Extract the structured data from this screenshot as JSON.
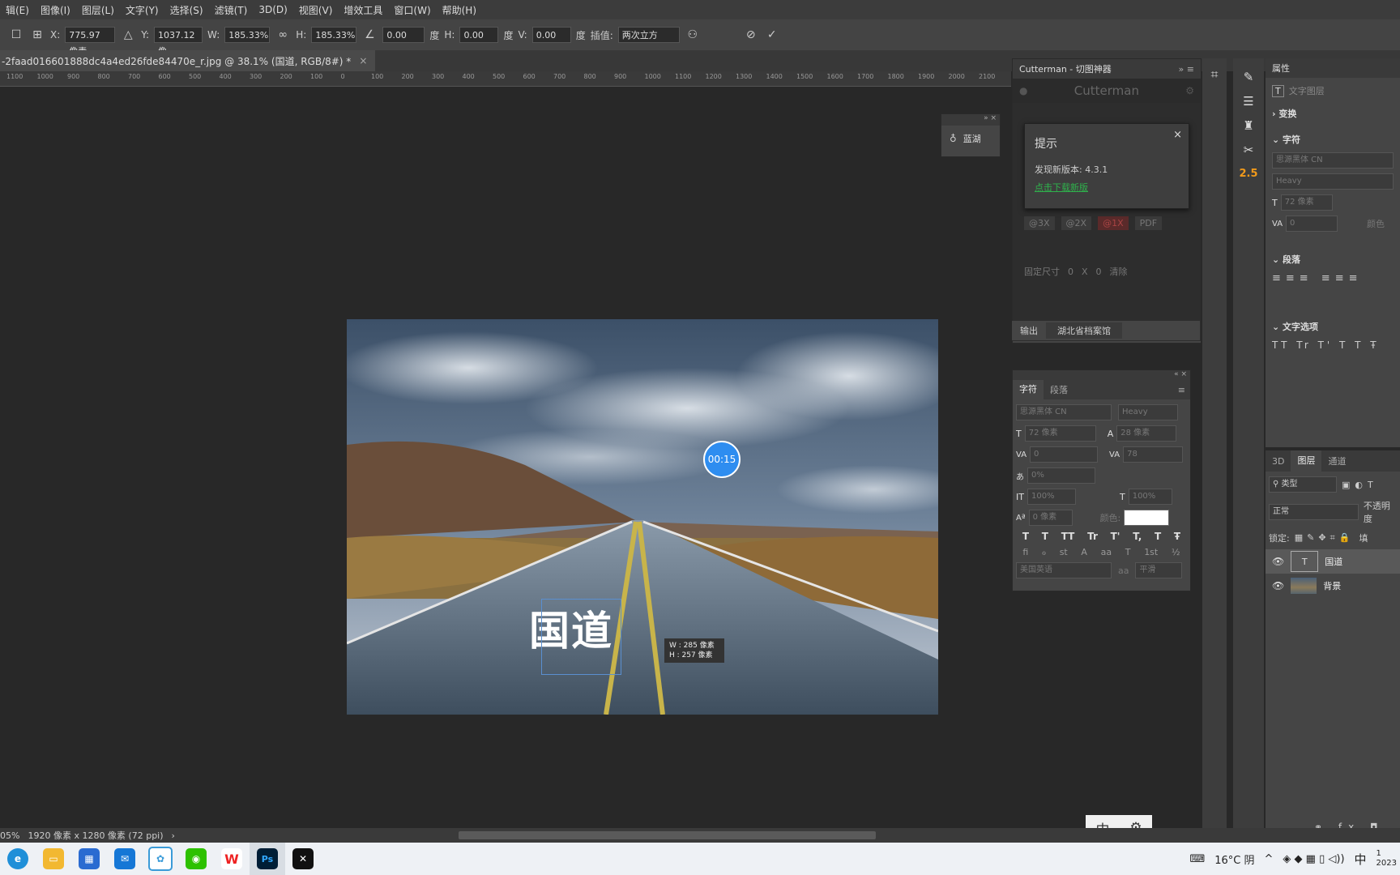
{
  "menu": [
    "辑(E)",
    "图像(I)",
    "图层(L)",
    "文字(Y)",
    "选择(S)",
    "滤镜(T)",
    "3D(D)",
    "视图(V)",
    "增效工具",
    "窗口(W)",
    "帮助(H)"
  ],
  "options": {
    "x_label": "X:",
    "x_value": "775.97 像素",
    "y_label": "Y:",
    "y_value": "1037.12 像",
    "w_label": "W:",
    "w_value": "185.33%",
    "h_label": "H:",
    "h_value": "185.33%",
    "angle_value": "0.00",
    "deg": "度",
    "hskew_label": "H:",
    "hskew_value": "0.00",
    "vskew_label": "V:",
    "vskew_value": "0.00",
    "interp_label": "插值:",
    "interp_value": "两次立方"
  },
  "doc_tab": {
    "title": "-2faad016601888dc4a4ed26fde84470e_r.jpg @ 38.1% (国道, RGB/8#) *",
    "close": "×"
  },
  "ruler_ticks": [
    "1100",
    "1000",
    "900",
    "800",
    "700",
    "600",
    "500",
    "400",
    "300",
    "200",
    "100",
    "0",
    "100",
    "200",
    "300",
    "400",
    "500",
    "600",
    "700",
    "800",
    "900",
    "1000",
    "1100",
    "1200",
    "1300",
    "1400",
    "1500",
    "1600",
    "1700",
    "1800",
    "1900",
    "2000",
    "2100"
  ],
  "canvas": {
    "text": "国道",
    "timer": "00:15",
    "tooltip_w": "W :  285 像素",
    "tooltip_h": "H :  257 像素"
  },
  "float_panel": {
    "label": "蓝湖"
  },
  "cutterman": {
    "tab": "Cutterman - 切图神器",
    "brand": "Cutterman",
    "dialog_title": "提示",
    "dialog_msg": "发现新版本: 4.3.1",
    "dialog_link": "点击下载新版",
    "scales": [
      "@3X",
      "@2X",
      "@1X",
      "PDF"
    ],
    "fixed_label": "固定尺寸",
    "fixed_w": "0",
    "fixed_x": "X",
    "fixed_h": "0",
    "clear": "清除",
    "output_label": "输出",
    "output_path": "湖北省档案馆"
  },
  "char_panel": {
    "tabs": [
      "字符",
      "段落"
    ],
    "font": "思源黑体 CN",
    "style": "Heavy",
    "size": "72 像素",
    "leading": "28 像素",
    "kern": "0",
    "track": "78",
    "scale_pct": "0%",
    "vscale": "100%",
    "hscale": "100%",
    "baseline": "0 像素",
    "color_label": "颜色:",
    "lang": "美国英语",
    "aa_label": "aa",
    "aa": "平滑",
    "typo_buttons": [
      "T",
      "T",
      "TT",
      "Tr",
      "T'",
      "T,",
      "T",
      "Ŧ"
    ],
    "ot_buttons": [
      "fi",
      "ℴ",
      "st",
      "A",
      "aa",
      "T",
      "1st",
      "½"
    ]
  },
  "properties": {
    "tab": "属性",
    "layer_type": "文字图层",
    "sections": [
      "变换",
      "字符",
      "段落",
      "文字选项"
    ],
    "font": "思源黑体 CN",
    "style": "Heavy",
    "size": "72 像素",
    "kern": "0",
    "color_label": "颜色"
  },
  "layers": {
    "tabs": [
      "3D",
      "图层",
      "通道"
    ],
    "filter": "类型",
    "blend": "正常",
    "opacity_label": "不透明度",
    "lock_label": "锁定:",
    "fill_label": "填",
    "items": [
      {
        "name": "国道",
        "type": "text"
      },
      {
        "name": "背景",
        "type": "image"
      }
    ]
  },
  "status": {
    "zoom": "05%",
    "size": "1920 像素 x 1280 像素 (72 ppi)"
  },
  "ime": {
    "mode": "中"
  },
  "taskbar": {
    "weather": "16°C 阴",
    "ime": "中",
    "time": "1",
    "date": "2023",
    "apps": [
      "edge",
      "explorer",
      "store",
      "mail",
      "app",
      "wechat",
      "wps",
      "ps",
      "capcut"
    ]
  },
  "colors": {
    "accent": "#31a8ff",
    "link": "#2fb24c",
    "panel": "#454545",
    "bg": "#282828"
  }
}
